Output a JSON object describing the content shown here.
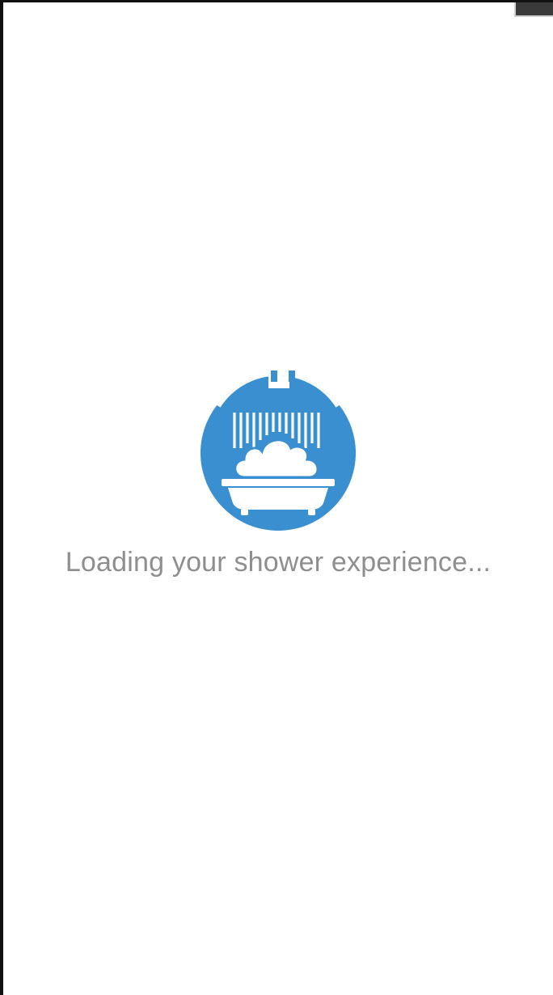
{
  "splash": {
    "logo_icon": "shower-bathtub-icon",
    "loading_text": "Loading your shower experience..."
  },
  "colors": {
    "brand_blue": "#3a8fd0",
    "text_gray": "#8e8e8e",
    "background": "#ffffff"
  }
}
